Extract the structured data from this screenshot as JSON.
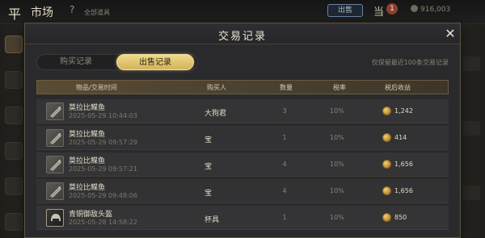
{
  "topbar": {
    "glyph": "平",
    "title": "市场",
    "help": "?",
    "category": "全部道具",
    "button": "出售",
    "glyph2": "当",
    "badge": "1",
    "currency": "916,003"
  },
  "modal": {
    "title": "交易记录",
    "close": "✕",
    "tabs": [
      {
        "label": "购买记录",
        "active": false
      },
      {
        "label": "出售记录",
        "active": true
      }
    ],
    "hint": "仅保留最近100条交易记录",
    "columns": [
      "物品/交易时间",
      "购买人",
      "数量",
      "税率",
      "税后收益"
    ],
    "rows": [
      {
        "icon": "fish-icon",
        "name": "莫拉比鲽鱼",
        "time": "2025-05-29 10:44:03",
        "buyer": "大狗君",
        "qty": "3",
        "tax": "10%",
        "income": "1,242"
      },
      {
        "icon": "fish-icon",
        "name": "莫拉比鲽鱼",
        "time": "2025-05-29 09:57:29",
        "buyer": "宝",
        "qty": "1",
        "tax": "10%",
        "income": "414"
      },
      {
        "icon": "fish-icon",
        "name": "莫拉比鲽鱼",
        "time": "2025-05-29 09:57:21",
        "buyer": "宝",
        "qty": "4",
        "tax": "10%",
        "income": "1,656"
      },
      {
        "icon": "fish-icon",
        "name": "莫拉比鲽鱼",
        "time": "2025-05-29 09:48:06",
        "buyer": "宝",
        "qty": "4",
        "tax": "10%",
        "income": "1,656"
      },
      {
        "icon": "helmet-icon",
        "name": "青铜御敌头盔",
        "time": "2025-05-28 14:58:22",
        "buyer": "杯具",
        "qty": "1",
        "tax": "10%",
        "income": "850"
      }
    ]
  },
  "colors": {
    "accent_gold": "#d3b25b",
    "header_band": "#5a4b33",
    "panel_bg": "#2a2a2c"
  }
}
